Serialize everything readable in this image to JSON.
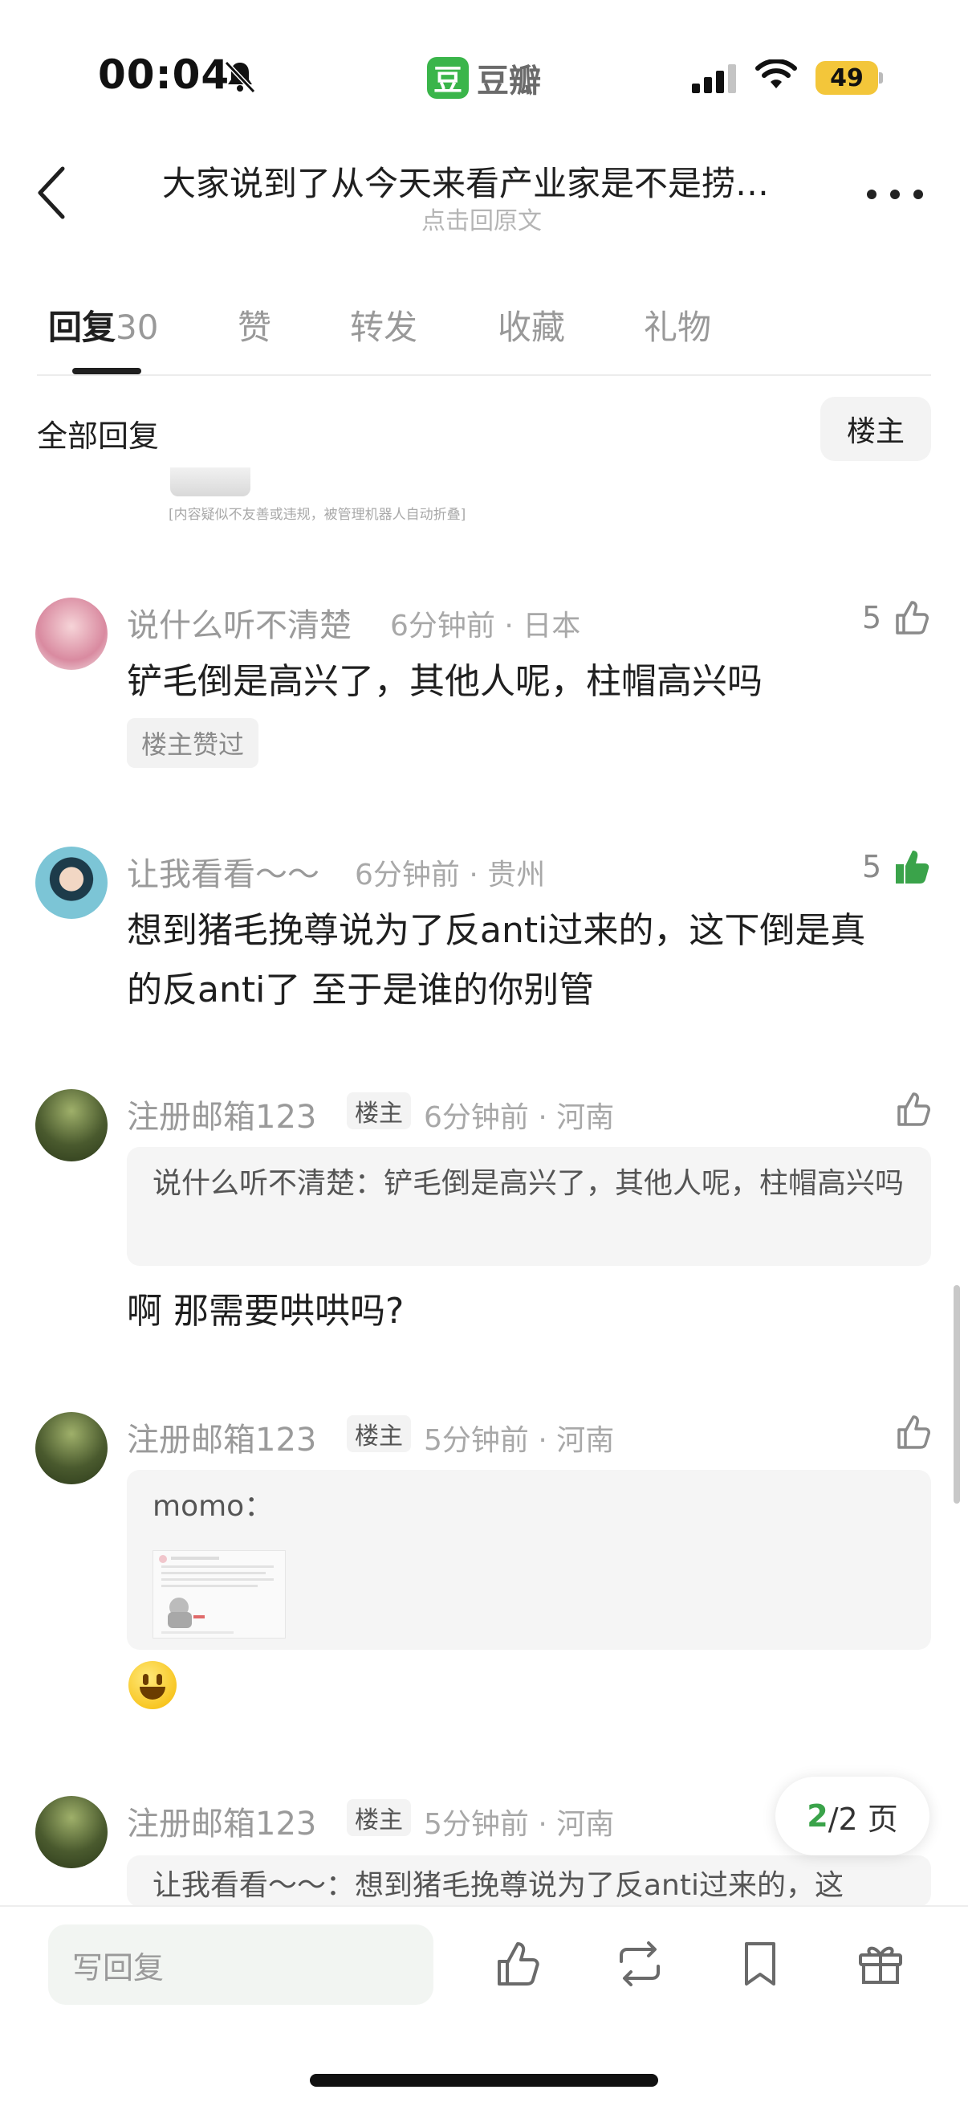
{
  "status_bar": {
    "time": "00:04",
    "battery": "49",
    "app_logo_char": "豆",
    "app_name": "豆瓣"
  },
  "header": {
    "title": "大家说到了从今天来看产业家是不是捞…",
    "subtitle": "点击回原文"
  },
  "tabs": [
    {
      "label": "回复",
      "count": "30"
    },
    {
      "label": "赞"
    },
    {
      "label": "转发"
    },
    {
      "label": "收藏"
    },
    {
      "label": "礼物"
    }
  ],
  "filter": {
    "label": "全部回复",
    "op_button": "楼主"
  },
  "folded_note": "[内容疑似不友善或违规，被管理机器人自动折叠]",
  "comments": [
    {
      "username": "说什么听不清楚",
      "meta": "6分钟前 · 日本",
      "likes": "5",
      "text": "铲毛倒是高兴了，其他人呢，柱帽高兴吗",
      "tag": "楼主赞过",
      "avatar_color": "#e8b3c0"
    },
    {
      "username": "让我看看～～",
      "meta": "6分钟前 · 贵州",
      "likes": "5",
      "liked": true,
      "text_lines": [
        "想到猪毛挽尊说为了反anti过来的，这下倒是真",
        "的反anti了 至于是谁的你别管"
      ],
      "avatar_color": "#3fa6b8"
    },
    {
      "username": "注册邮箱123",
      "badge": "楼主",
      "meta": "6分钟前 · 河南",
      "quote": "说什么听不清楚：铲毛倒是高兴了，其他人呢，柱帽高兴吗",
      "text": "啊 那需要哄哄吗?",
      "avatar_color": "#4a5a2e"
    },
    {
      "username": "注册邮箱123",
      "badge": "楼主",
      "meta": "5分钟前 · 河南",
      "quote": "momo：",
      "emoji": "smile",
      "avatar_color": "#4a5a2e"
    },
    {
      "username": "注册邮箱123",
      "badge": "楼主",
      "meta": "5分钟前 · 河南",
      "quote": "让我看看～～：想到猪毛挽尊说为了反anti过来的，这",
      "avatar_color": "#4a5a2e"
    }
  ],
  "pagination": {
    "current": "2",
    "total": "/2 页"
  },
  "bottom_bar": {
    "reply_placeholder": "写回复"
  },
  "colors": {
    "accent_green": "#3aa34a",
    "text_primary": "#1f1f1f",
    "text_muted": "#9a9a9a"
  },
  "icons": [
    "back-icon",
    "more-icon",
    "like-icon",
    "repost-icon",
    "bookmark-icon",
    "gift-icon",
    "mute-bell-icon",
    "signal-icon",
    "wifi-icon"
  ]
}
